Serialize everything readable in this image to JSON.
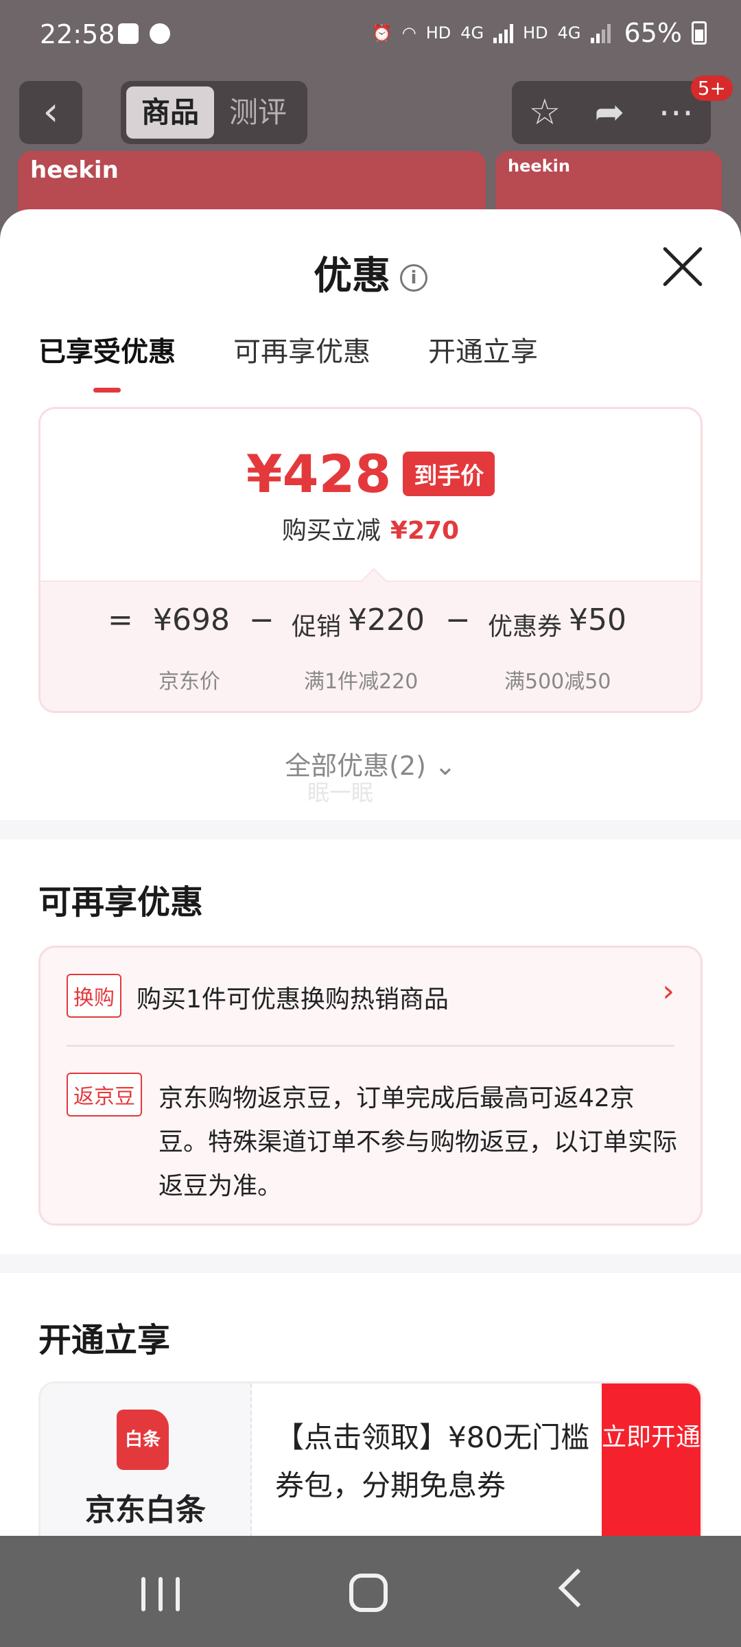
{
  "status_bar": {
    "time": "22:58",
    "network": "HD",
    "signal1": "4G",
    "signal2": "4G",
    "battery": "65%"
  },
  "header": {
    "tabs": [
      "商品",
      "测评"
    ],
    "badge": "5+",
    "brand": "heekin"
  },
  "sheet": {
    "title": "优惠",
    "tabs": [
      "已享受优惠",
      "可再享优惠",
      "开通立享"
    ],
    "price": {
      "final_price": "¥428",
      "final_tag": "到手价",
      "reduce_label": "购买立减",
      "reduce_value": "¥270",
      "eq": "=",
      "minus": "−",
      "base_price": "¥698",
      "base_label": "京东价",
      "promo_label": "促销",
      "promo_value": "¥220",
      "promo_rule": "满1件减220",
      "coupon_label": "优惠券",
      "coupon_value": "¥50",
      "coupon_rule": "满500减50"
    },
    "all_discounts": "全部优惠(2)",
    "watermark": "眠一眠",
    "more_section": {
      "title": "可再享优惠",
      "items": [
        {
          "tag": "换购",
          "text": "购买1件可优惠换购热销商品"
        },
        {
          "tag": "返京豆",
          "text": "京东购物返京豆，订单完成后最高可返42京豆。特殊渠道订单不参与购物返豆，以订单实际返豆为准。"
        }
      ]
    },
    "open_section": {
      "title": "开通立享",
      "logo_text": "白条",
      "name": "京东白条",
      "description": "【点击领取】¥80无门槛券包，分期免息券",
      "button": "立即开通"
    }
  },
  "colors": {
    "accent": "#e4393c",
    "card_border": "#f8dde0",
    "overlay": "#6e6668",
    "nav_bar": "#646464"
  }
}
